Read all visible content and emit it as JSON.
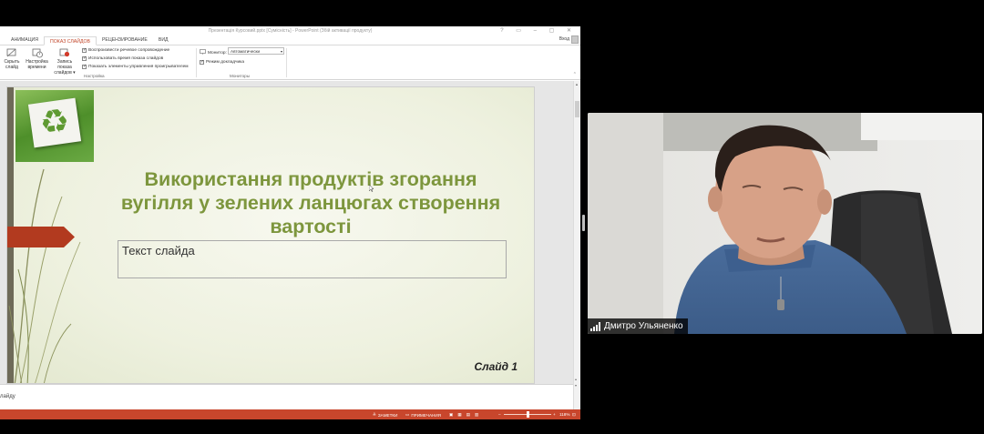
{
  "powerpoint": {
    "window_title": "Презентація Курсовий.pptx [Сумісність] - PowerPoint (Збій активації продукту)",
    "window_controls": "? ▭ – ▢ ✕",
    "tabs": [
      {
        "label": "АНИМАЦИЯ",
        "active": false
      },
      {
        "label": "ПОКАЗ СЛАЙДОВ",
        "active": true
      },
      {
        "label": "РЕЦЕНЗИРОВАНИЕ",
        "active": false
      },
      {
        "label": "ВИД",
        "active": false
      }
    ],
    "sign_in": "Вход",
    "ribbon": {
      "hide_slide": "Скрыть\nслайд",
      "rehearse": "Настройка\nвремени",
      "record": "Запись показа\nслайдов ▾",
      "checks": [
        {
          "label": "Воспроизвести речевое сопровождение",
          "checked": true
        },
        {
          "label": "Использовать время показа слайдов",
          "checked": true
        },
        {
          "label": "Показать элементы управления проигрывателем",
          "checked": true
        }
      ],
      "group_setup": "Настройка",
      "monitor_label": "Монитор:",
      "monitor_value": "Автоматически",
      "presenter_view": {
        "label": "Режим докладчика",
        "checked": true
      },
      "group_monitors": "Мониторы"
    },
    "slide": {
      "title": "Використання продуктів згорання вугілля у зелених ланцюгах створення вартості",
      "body_placeholder": "Текст слайда",
      "number": "Слайд 1",
      "recycle_symbol": "♻"
    },
    "notes_text": "лайду",
    "status": {
      "notes_btn": "ЗАМЕТКИ",
      "comments_btn": "ПРИМЕЧАНИЯ",
      "zoom": "118%"
    },
    "colors": {
      "accent": "#c8462c",
      "title_green": "#7d963d",
      "arrow_red": "#b23a1f"
    }
  },
  "camera": {
    "participant_name": "Дмитро Ульяненко",
    "signal_icon": "signal-bars-icon"
  }
}
